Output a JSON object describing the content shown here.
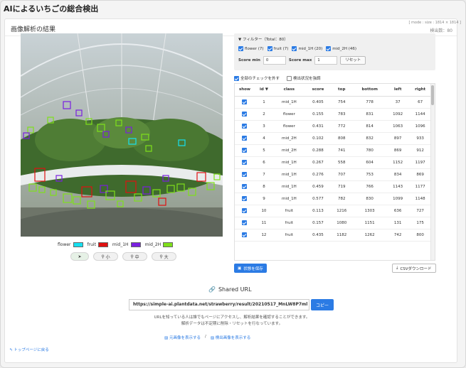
{
  "app": {
    "title": "AIによるいちごの総合検出"
  },
  "panel": {
    "title": "画像解析の結果",
    "count_text": "検出数：80",
    "mode_text": "[ mode : size : 1814 × 1814 ]"
  },
  "legend": [
    {
      "label": "flower",
      "color": "#16e0f0"
    },
    {
      "label": "fruit",
      "color": "#e01010"
    },
    {
      "label": "mid_1H",
      "color": "#7a1fe0"
    },
    {
      "label": "mid_2H",
      "color": "#7fe01a"
    }
  ],
  "zoom": {
    "small": "小",
    "medium": "中",
    "large": "大"
  },
  "filter": {
    "title": "フィルター（Total：80）",
    "items": [
      "flower (7)",
      "fruit (7)",
      "mid_1H (20)",
      "mid_2H (46)"
    ],
    "score_min_label": "Score min",
    "score_min_value": "0",
    "score_max_label": "Score max",
    "score_max_value": "1",
    "reset_label": "リセット"
  },
  "checks": {
    "uncheck_all": "全部のチェックを外す",
    "highlight": "検出状況を強調"
  },
  "table": {
    "headers": [
      "show",
      "id ▼",
      "class",
      "score",
      "top",
      "bottom",
      "left",
      "right"
    ],
    "rows": [
      [
        "1",
        "mid_1H",
        "0.405",
        "754",
        "778",
        "37",
        "67"
      ],
      [
        "2",
        "flower",
        "0.155",
        "783",
        "831",
        "1092",
        "1144"
      ],
      [
        "3",
        "flower",
        "0.431",
        "772",
        "814",
        "1063",
        "1096"
      ],
      [
        "4",
        "mid_2H",
        "0.102",
        "808",
        "832",
        "897",
        "933"
      ],
      [
        "5",
        "mid_2H",
        "0.288",
        "741",
        "780",
        "869",
        "912"
      ],
      [
        "6",
        "mid_1H",
        "0.267",
        "558",
        "604",
        "1152",
        "1197"
      ],
      [
        "7",
        "mid_1H",
        "0.276",
        "707",
        "753",
        "834",
        "869"
      ],
      [
        "8",
        "mid_1H",
        "0.459",
        "719",
        "766",
        "1143",
        "1177"
      ],
      [
        "9",
        "mid_1H",
        "0.577",
        "782",
        "830",
        "1099",
        "1148"
      ],
      [
        "10",
        "fruit",
        "0.113",
        "1216",
        "1303",
        "636",
        "727"
      ],
      [
        "11",
        "fruit",
        "0.157",
        "1080",
        "1151",
        "131",
        "175"
      ],
      [
        "12",
        "fruit",
        "0.435",
        "1182",
        "1262",
        "742",
        "800"
      ]
    ]
  },
  "buttons": {
    "save": "状態を保存",
    "csv": "CSVダウンロード",
    "copy": "コピー"
  },
  "share": {
    "title": "Shared URL",
    "url": "https://simple-ai.plantdata.net/strawberry/result/20210517_MnLW8P7ml",
    "notice_line1": "URLを知っている人は誰でもページにアクセスし、解析結果を確認することができます。",
    "notice_line2": "解析データは不定期に削除・リセットを行なっています。",
    "link_original": "元画像を表示する",
    "link_detect": "検出画像を表示する",
    "separator": "/"
  },
  "nav": {
    "back": "トップページに戻る"
  }
}
